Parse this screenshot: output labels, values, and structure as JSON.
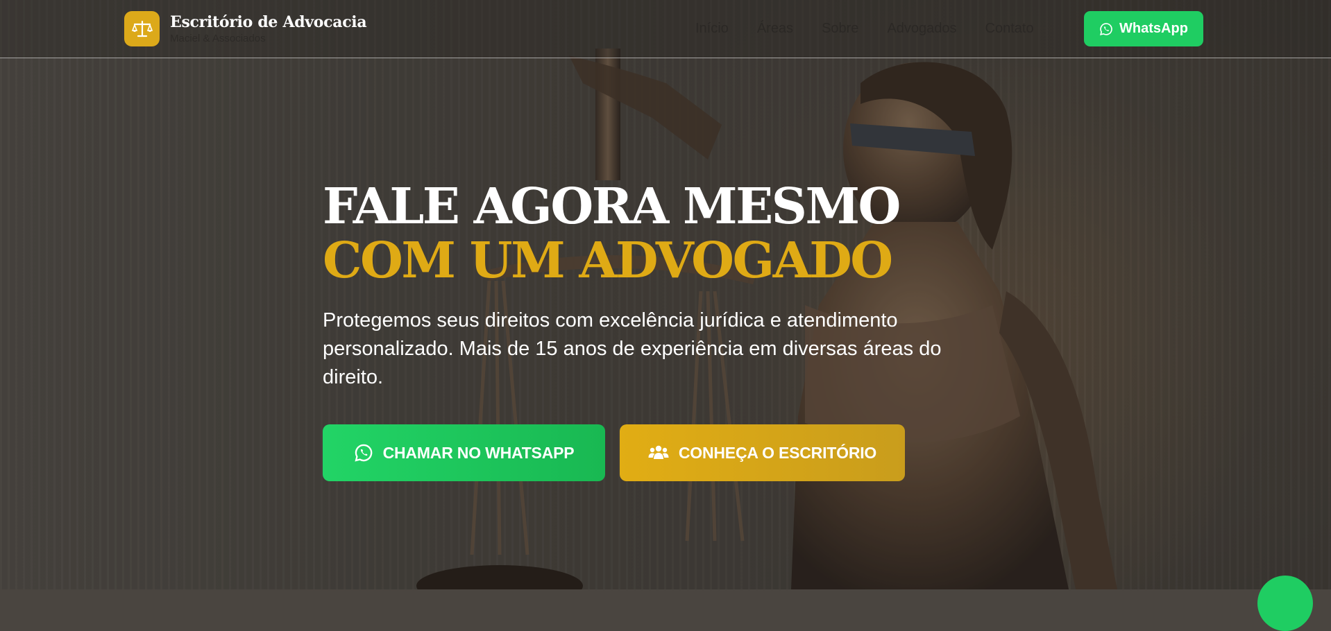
{
  "header": {
    "brand_title": "Escritório de Advocacia",
    "brand_subtitle": "Maciel & Associados",
    "logo_icon": "scales-icon",
    "nav": [
      "Início",
      "Áreas",
      "Sobre",
      "Advogados",
      "Contato"
    ],
    "whatsapp_label": "WhatsApp"
  },
  "hero": {
    "title_line1": "FALE AGORA MESMO",
    "title_line2": "COM UM ADVOGADO",
    "lead": "Protegemos seus direitos com excelência jurídica e atendimento personalizado. Mais de 15 anos de experiência em diversas áreas do direito.",
    "cta_whatsapp": "CHAMAR NO WHATSAPP",
    "cta_office": "CONHEÇA O ESCRITÓRIO"
  },
  "colors": {
    "accent_gold": "#dfaa15",
    "whatsapp_green": "#1fcd62",
    "text_white": "#ffffff"
  }
}
